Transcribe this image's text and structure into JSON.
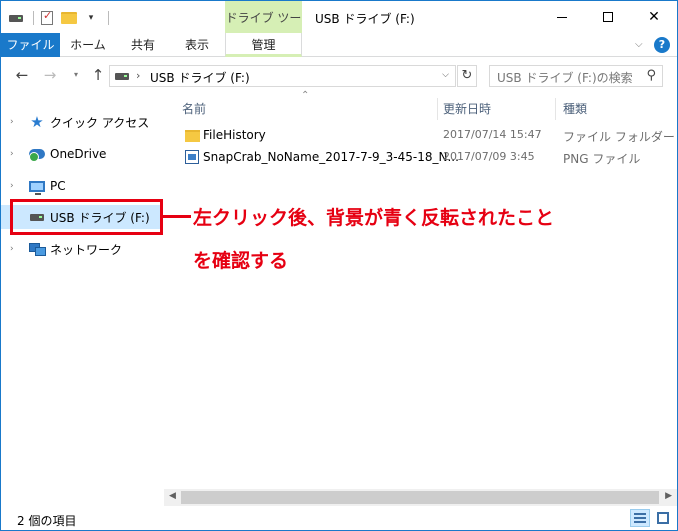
{
  "window": {
    "title": "USB ドライブ (F:)",
    "tools_tab": "ドライブ ツール"
  },
  "ribbon": {
    "tabs": [
      "ファイル",
      "ホーム",
      "共有",
      "表示",
      "管理"
    ],
    "help": "?"
  },
  "address": {
    "path": "USB ドライブ (F:)",
    "search_placeholder": "USB ドライブ (F:)の検索"
  },
  "nav_pane": {
    "items": [
      {
        "label": "クイック アクセス",
        "icon": "star-icon"
      },
      {
        "label": "OneDrive",
        "icon": "onedrive-icon"
      },
      {
        "label": "PC",
        "icon": "pc-icon"
      },
      {
        "label": "USB ドライブ (F:)",
        "icon": "usb-drive-icon",
        "selected": true
      },
      {
        "label": "ネットワーク",
        "icon": "network-icon"
      }
    ]
  },
  "file_list": {
    "columns": [
      "名前",
      "更新日時",
      "種類"
    ],
    "rows": [
      {
        "name": "FileHistory",
        "date": "2017/07/14 15:47",
        "type": "ファイル フォルダー",
        "icon": "folder-icon"
      },
      {
        "name": "SnapCrab_NoName_2017-7-9_3-45-18_N...",
        "date": "2017/07/09 3:45",
        "type": "PNG ファイル",
        "icon": "png-file-icon"
      }
    ]
  },
  "annotation": {
    "line1": "左クリック後、背景が青く反転されたこと",
    "line2": "を確認する",
    "color": "#e60012"
  },
  "status": {
    "item_count": "2 個の項目"
  }
}
